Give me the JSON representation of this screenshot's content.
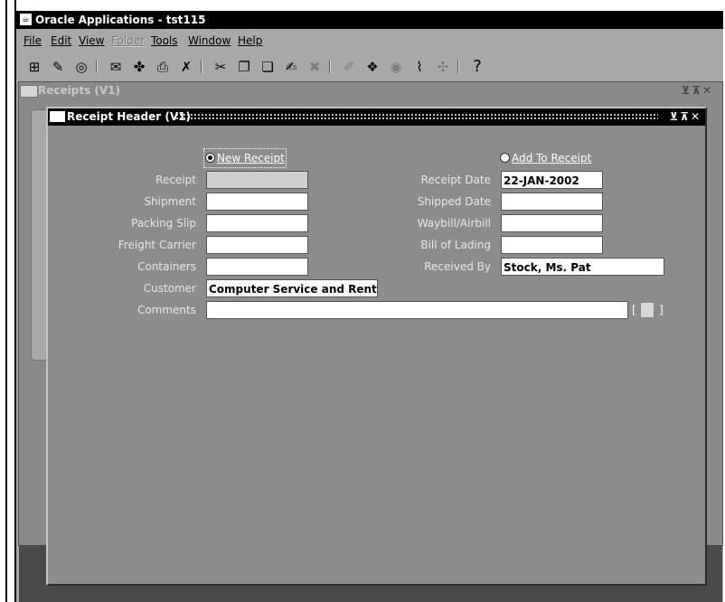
{
  "app": {
    "title": "Oracle Applications - tst115"
  },
  "menu": [
    {
      "label": "File",
      "disabled": false
    },
    {
      "label": "Edit",
      "disabled": false
    },
    {
      "label": "View",
      "disabled": false
    },
    {
      "label": "Folder",
      "disabled": true
    },
    {
      "label": "Tools",
      "disabled": false
    },
    {
      "label": "Window",
      "disabled": false
    },
    {
      "label": "Help",
      "disabled": false
    }
  ],
  "toolbar": {
    "help": "?"
  },
  "background_window": {
    "title": "Receipts (V1)",
    "controls": "⊻⊼✕"
  },
  "dialog": {
    "title": "Receipt Header (V1)",
    "controls": "⊻⊼✕",
    "radio_new": "New Receipt",
    "radio_add": "Add To Receipt",
    "fields": {
      "receipt": {
        "label": "Receipt",
        "value": ""
      },
      "shipment": {
        "label": "Shipment",
        "value": ""
      },
      "packing_slip": {
        "label": "Packing Slip",
        "value": ""
      },
      "freight_carrier": {
        "label": "Freight Carrier",
        "value": ""
      },
      "containers": {
        "label": "Containers",
        "value": ""
      },
      "customer": {
        "label": "Customer",
        "value": "Computer Service and Rental"
      },
      "comments": {
        "label": "Comments",
        "value": ""
      },
      "receipt_date": {
        "label": "Receipt Date",
        "value": "22-JAN-2002"
      },
      "shipped_date": {
        "label": "Shipped Date",
        "value": ""
      },
      "waybill": {
        "label": "Waybill/Airbill",
        "value": ""
      },
      "bill_of_lading": {
        "label": "Bill of Lading",
        "value": ""
      },
      "received_by": {
        "label": "Received By",
        "value": "Stock, Ms. Pat"
      }
    },
    "brackets": {
      "open": "[",
      "close": "]"
    }
  }
}
